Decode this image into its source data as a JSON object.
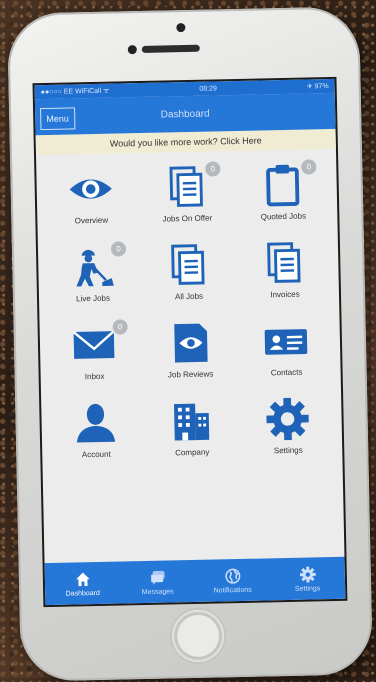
{
  "status_bar": {
    "carrier": "●●○○○ EE WiFiCall ᯤ",
    "time": "08:29",
    "battery": "✈ 97%"
  },
  "nav": {
    "menu_label": "Menu",
    "title": "Dashboard"
  },
  "promo": {
    "text": "Would you like more work? Click Here"
  },
  "tiles": [
    {
      "label": "Overview",
      "icon": "eye-icon"
    },
    {
      "label": "Jobs On Offer",
      "icon": "documents-icon",
      "badge": "0"
    },
    {
      "label": "Quoted Jobs",
      "icon": "clipboard-icon",
      "badge": "0"
    },
    {
      "label": "Live Jobs",
      "icon": "worker-icon",
      "badge": "0"
    },
    {
      "label": "All Jobs",
      "icon": "documents-icon"
    },
    {
      "label": "Invoices",
      "icon": "documents-icon"
    },
    {
      "label": "Inbox",
      "icon": "envelope-icon",
      "badge": "0"
    },
    {
      "label": "Job Reviews",
      "icon": "review-icon"
    },
    {
      "label": "Contacts",
      "icon": "contact-card-icon"
    },
    {
      "label": "Account",
      "icon": "person-icon"
    },
    {
      "label": "Company",
      "icon": "building-icon"
    },
    {
      "label": "Settings",
      "icon": "gear-icon"
    }
  ],
  "tabbar": [
    {
      "label": "Dashboard",
      "icon": "home-icon"
    },
    {
      "label": "Messages",
      "icon": "chat-icon"
    },
    {
      "label": "Notifications",
      "icon": "globe-icon"
    },
    {
      "label": "Settings",
      "icon": "gear-icon"
    }
  ],
  "colors": {
    "primary": "#2577d8",
    "icon_blue": "#1e63b8",
    "promo_bg": "#efecd3",
    "badge": "#b5b8bd"
  }
}
